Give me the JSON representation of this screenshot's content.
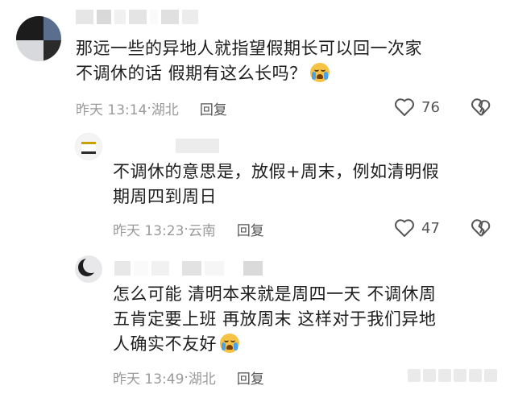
{
  "comments": [
    {
      "text_line1": "那远一些的异地人就指望假期长可以回一次家",
      "text_line2": "不调休的话 假期有这么长吗？",
      "emoji": "crying-face",
      "time": "昨天 13:14",
      "region": "湖北",
      "reply_label": "回复",
      "likes": "76"
    },
    {
      "text_line1": "不调休的意思是，放假+周末，例如清明假",
      "text_line2": "期周四到周日",
      "time": "昨天 13:23",
      "region": "云南",
      "reply_label": "回复",
      "likes": "47"
    },
    {
      "text_line1": "怎么可能 清明本来就是周四一天 不调休周",
      "text_line2": "五肯定要上班 再放周末 这样对于我们异地",
      "text_line3": "人确实不友好",
      "emoji": "crying-face",
      "time": "昨天 13:49",
      "region": "湖北",
      "reply_label": "回复"
    }
  ],
  "separator": "·",
  "icons": [
    "heart-outline-icon",
    "broken-heart-icon",
    "crying-face-emoji"
  ]
}
